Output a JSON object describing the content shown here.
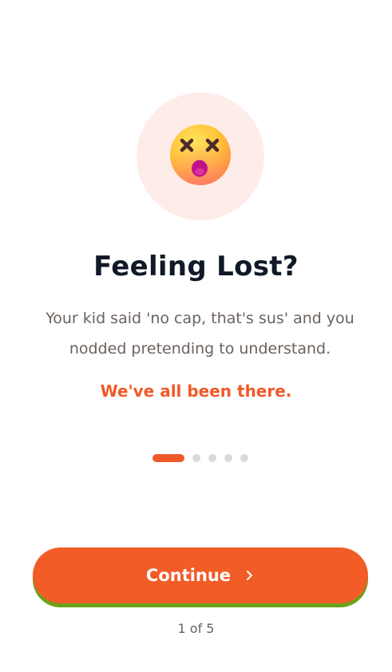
{
  "onboarding": {
    "title": "Feeling Lost?",
    "body": "Your kid said 'no cap, that's sus' and you nodded pretending to understand.",
    "highlight": "We've all been there.",
    "hero_icon": "dizzy-face-emoji",
    "continue_label": "Continue",
    "continue_icon": "chevron-right-icon",
    "step_indicator": "1 of 5",
    "pagination": {
      "current": 1,
      "total": 5
    }
  },
  "colors": {
    "accent": "#f25c27",
    "accent_shadow": "#6aa21a",
    "hero_bg": "#fdece8",
    "title": "#111827",
    "body": "#6b625e",
    "dot_inactive": "#d9d9d9"
  }
}
